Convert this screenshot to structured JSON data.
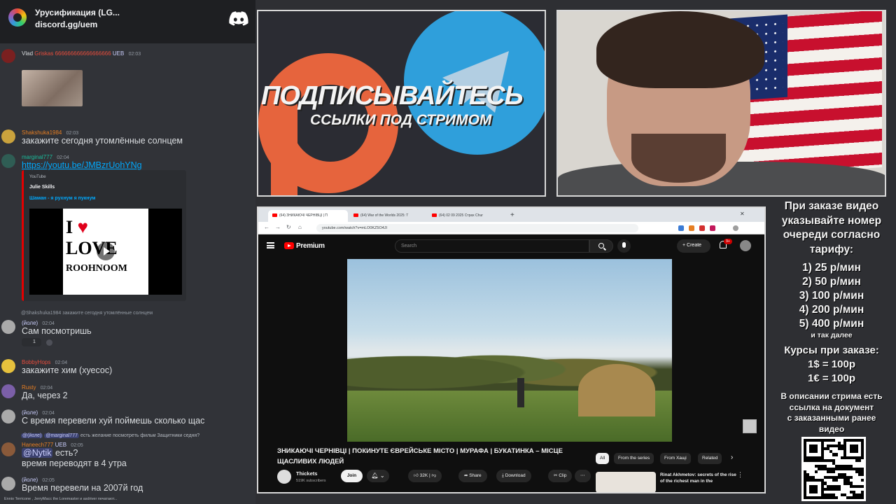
{
  "discord": {
    "server_name": "Урусификация (LG...",
    "server_link": "discord.gg/uem",
    "messages": [
      {
        "user": "Vlad",
        "user_extra": "Griskas 666666666666666666",
        "badges": "UEB",
        "time": "02:03",
        "text": "",
        "user_color": "#dbdee1",
        "avatar": "#7a2020"
      },
      {
        "user": "Shakshuka1984",
        "badges": "",
        "time": "02:03",
        "text": "закажите сегодня утомлённые солнцем",
        "user_color": "#e67e22",
        "avatar": "#c9a23d"
      },
      {
        "user": "marginal777",
        "badges": "",
        "time": "02:04",
        "text": "https://youtu.be/JMBzrUohYNg",
        "user_color": "#1abc9c",
        "avatar": "#2f5d54"
      },
      {
        "user": "(йоле)",
        "badges": "",
        "time": "02:04",
        "text": "Сам посмотришь",
        "reply": "@Shakshuka1984 закажите сегодня утомлённые солнцем",
        "reactions": "1",
        "user_color": "#c9cdfb",
        "avatar": "#aaaaaa"
      },
      {
        "user": "BobbyHops",
        "badges": "",
        "time": "02:04",
        "text": "закажите хим (хуесос)",
        "user_color": "#e74c3c",
        "avatar": "#e6c13d"
      },
      {
        "user": "Rusty",
        "badges": "",
        "time": "02:04",
        "text": "Да, через 2",
        "user_color": "#e67e22",
        "avatar": "#7b5fa8"
      },
      {
        "user": "(йоле)",
        "badges": "",
        "time": "02:04",
        "text": "С время перевели хуй поймешь сколько щас",
        "user_color": "#c9cdfb",
        "avatar": "#aaaaaa"
      },
      {
        "user": "Haneech777",
        "badges": "UEB",
        "time": "02:05",
        "text_mention": "@Nytik",
        "text": "есть?",
        "text2": "время переводят в 4 утра",
        "reply_user": "@(йоле)",
        "reply_mention": "@marginal777",
        "reply": "есть желание посмотреть фильм Защитники седня?",
        "user_color": "#e67e22",
        "avatar": "#8a5a3a"
      },
      {
        "user": "(йоле)",
        "badges": "",
        "time": "02:05",
        "text": "Время перевели на 2007й год",
        "user_color": "#c9cdfb",
        "avatar": "#aaaaaa"
      }
    ],
    "embed": {
      "provider": "YouTube",
      "author": "Julie Skills",
      "title": "Шаман - я рухнум я пукнум",
      "thumb_line1": "I",
      "thumb_heart": "♥",
      "thumb_line2": "LOVE",
      "thumb_line3": "ROOHNOOM"
    },
    "typing": "Ennio Terricone , JerryMacc the Loremaster и asdriver печатают..."
  },
  "promo": {
    "line1": "ПОДПИСЫВАЙТЕСЬ",
    "line2": "ССЫЛКИ ПОД СТРИМОМ"
  },
  "browser": {
    "tabs": [
      "(64) ЗНИКАЮЧІ ЧЕРНІВЦІ | П",
      "(64) War of the Worlds 2025: T",
      "(64) 02 09 2025 Страх Chur"
    ],
    "url": "youtube.com/watch?v=mLO0KZ5O4JI",
    "yt_brand": "Premium",
    "search_placeholder": "Search",
    "create_label": "Create",
    "notif_count": "9+",
    "video_title": "ЗНИКАЮЧІ ЧЕРНІВЦІ | ПОКИНУТЕ ЄВРЕЙСЬКЕ МІСТО | МУРАФА | БУКАТИНКА – МІСЦЕ ЩАСЛИВИХ ЛЮДЕЙ",
    "channel": "Thickets",
    "subscribers": "519K subscribers",
    "join_label": "Join",
    "likes": "32K",
    "share_label": "Share",
    "download_label": "Download",
    "clip_label": "Clip",
    "chips": [
      "All",
      "From the series",
      "From Хащі",
      "Related"
    ],
    "reco_title": "Rinat Akhmetov: secrets of the rise of the richest man in the"
  },
  "info": {
    "head": [
      "При заказе видео",
      "указывайте номер",
      "очереди согласно",
      "тарифу:"
    ],
    "prices": [
      "1) 25 р/мин",
      "2) 50 р/мин",
      "3) 100 р/мин",
      "4) 200 р/мин",
      "5) 400 р/мин"
    ],
    "etc": "и так далее",
    "rates": [
      "Курсы при заказе:",
      "1$ = 100р",
      "1€ = 100р"
    ],
    "desc": [
      "В описании стрима есть",
      "ссылка на документ",
      "с заказанными ранее",
      "видео"
    ]
  }
}
